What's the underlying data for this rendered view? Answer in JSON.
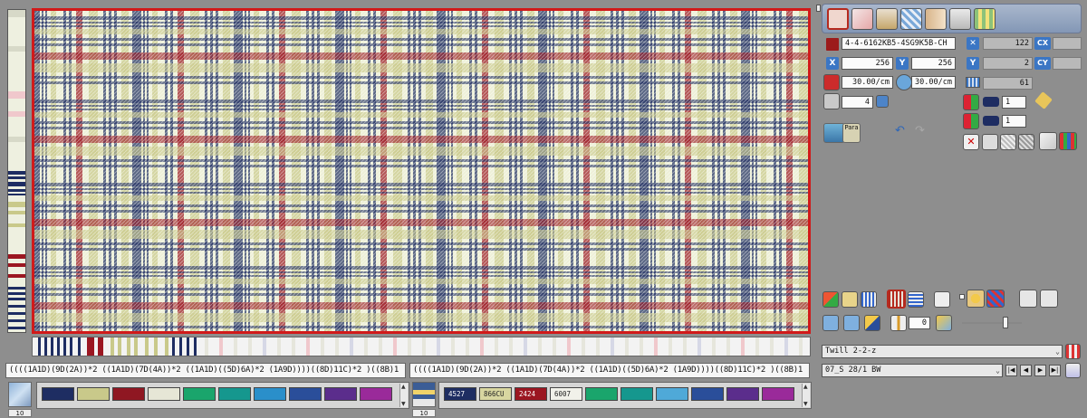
{
  "design": {
    "name": "4-4-6162KB5-4SG9K5B-CH",
    "warp_ends_label": "X",
    "weft_picks_label": "Y",
    "size_x": "256",
    "size_y": "256",
    "warp_density": "30.00/cm",
    "weft_density": "30.00/cm",
    "repeat_count": "4",
    "value_x": "122",
    "value_cx_label": "CX",
    "value_y": "2",
    "value_cy_label": "CY",
    "value_total": "61",
    "layer_a": "1",
    "layer_b": "1",
    "para_label": "Para"
  },
  "formulas": {
    "warp": "((((1A1D)(9D(2A))*2 ((1A1D)(7D(4A))*2 ((1A1D)((5D)6A)*2 (1A9D))))((8D)11C)*2 )((8B)1",
    "weft": "((((1A1D)(9D(2A))*2 ((1A1D)(7D(4A))*2 ((1A1D)((5D)6A)*2 (1A9D))))((8D)11C)*2 )((8B)1"
  },
  "tool_counters": {
    "warp": "10",
    "weft": "10"
  },
  "palette_warp": [
    {
      "color": "#1e2d62",
      "label": ""
    },
    {
      "color": "#c9c98a",
      "label": ""
    },
    {
      "color": "#8f1722",
      "label": ""
    },
    {
      "color": "#e6e6d6",
      "label": ""
    },
    {
      "color": "#1aa56c",
      "label": ""
    },
    {
      "color": "#15978e",
      "label": ""
    },
    {
      "color": "#2a8fca",
      "label": ""
    },
    {
      "color": "#2a4e9a",
      "label": ""
    },
    {
      "color": "#5b2d8c",
      "label": ""
    },
    {
      "color": "#9a2a9a",
      "label": ""
    }
  ],
  "palette_weft": [
    {
      "color": "#1e2d62",
      "label": "4527"
    },
    {
      "color": "#d8d6a0",
      "label": "866CU"
    },
    {
      "color": "#9b1621",
      "label": "2424"
    },
    {
      "color": "#f1f1ea",
      "label": "6007"
    },
    {
      "color": "#1aa56c",
      "label": ""
    },
    {
      "color": "#15978e",
      "label": ""
    },
    {
      "color": "#4fa9d8",
      "label": ""
    },
    {
      "color": "#2a4e9a",
      "label": ""
    },
    {
      "color": "#5b2d8c",
      "label": ""
    },
    {
      "color": "#9a2a9a",
      "label": ""
    }
  ],
  "weave": {
    "selected": "Twill 2-2-z"
  },
  "yarn": {
    "selected": "07_S  28/1 BW"
  },
  "colors": {
    "accent_red": "#d11a1a",
    "navy": "#1e2d62",
    "khaki": "#c9c98a",
    "burgundy": "#9b1621",
    "cream": "#eef0d8",
    "panel_header": "#8397b6"
  },
  "icons": [
    "fabric-view-icon",
    "weave-view-icon",
    "warp-icon",
    "check-icon",
    "split-icon",
    "measure-icon",
    "grid-icon",
    "file-icon",
    "x-axis-icon",
    "y-axis-icon",
    "density-warp-icon",
    "density-weft-icon",
    "repeat-icon",
    "lock-icon",
    "render-icon",
    "para-icon",
    "undo-icon",
    "redo-icon",
    "pencil-icon",
    "delete-icon"
  ]
}
